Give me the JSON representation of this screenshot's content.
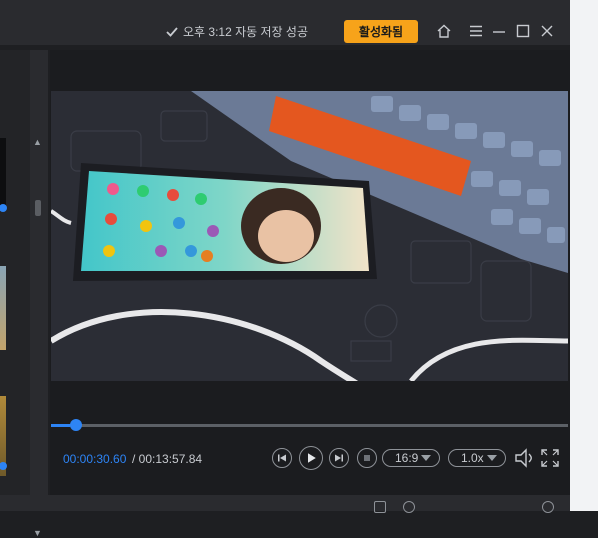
{
  "titlebar": {
    "autosave_text": "오후 3:12 자동 저장 성공",
    "activate_label": "활성화됨"
  },
  "player": {
    "current_time": "00:00:30.60",
    "total_time": "/ 00:13:57.84",
    "aspect_ratio": "16:9",
    "speed": "1.0x",
    "progress": 0.037
  },
  "colors": {
    "accent": "#2d84f5",
    "activate": "#f7a31a"
  }
}
